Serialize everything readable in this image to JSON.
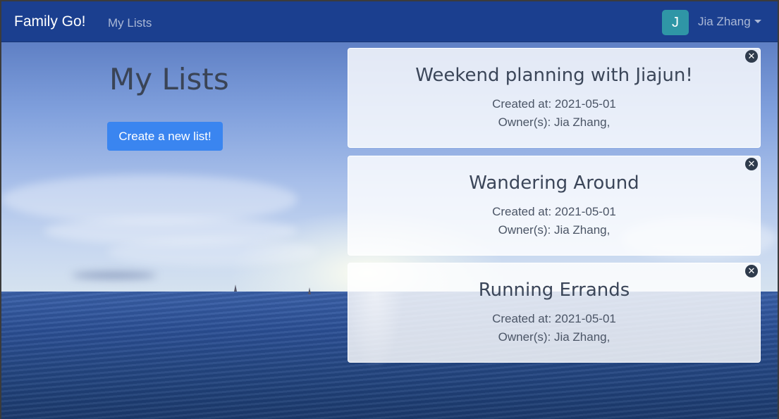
{
  "navbar": {
    "brand": "Family Go!",
    "links": [
      "My Lists"
    ],
    "user": {
      "avatar_initial": "J",
      "name": "Jia Zhang"
    }
  },
  "page": {
    "title": "My Lists",
    "create_button": "Create a new list!"
  },
  "lists": [
    {
      "title": "Weekend planning with Jiajun!",
      "created": "Created at: 2021-05-01",
      "owners": "Owner(s): Jia Zhang,"
    },
    {
      "title": "Wandering Around",
      "created": "Created at: 2021-05-01",
      "owners": "Owner(s): Jia Zhang,"
    },
    {
      "title": "Running Errands",
      "created": "Created at: 2021-05-01",
      "owners": "Owner(s): Jia Zhang,"
    }
  ],
  "colors": {
    "navbar": "#1b3f8f",
    "primary_button": "#3a85f0",
    "avatar": "#2f96a6"
  },
  "icons": {
    "close": "close-circle-icon",
    "caret": "chevron-down-icon"
  }
}
